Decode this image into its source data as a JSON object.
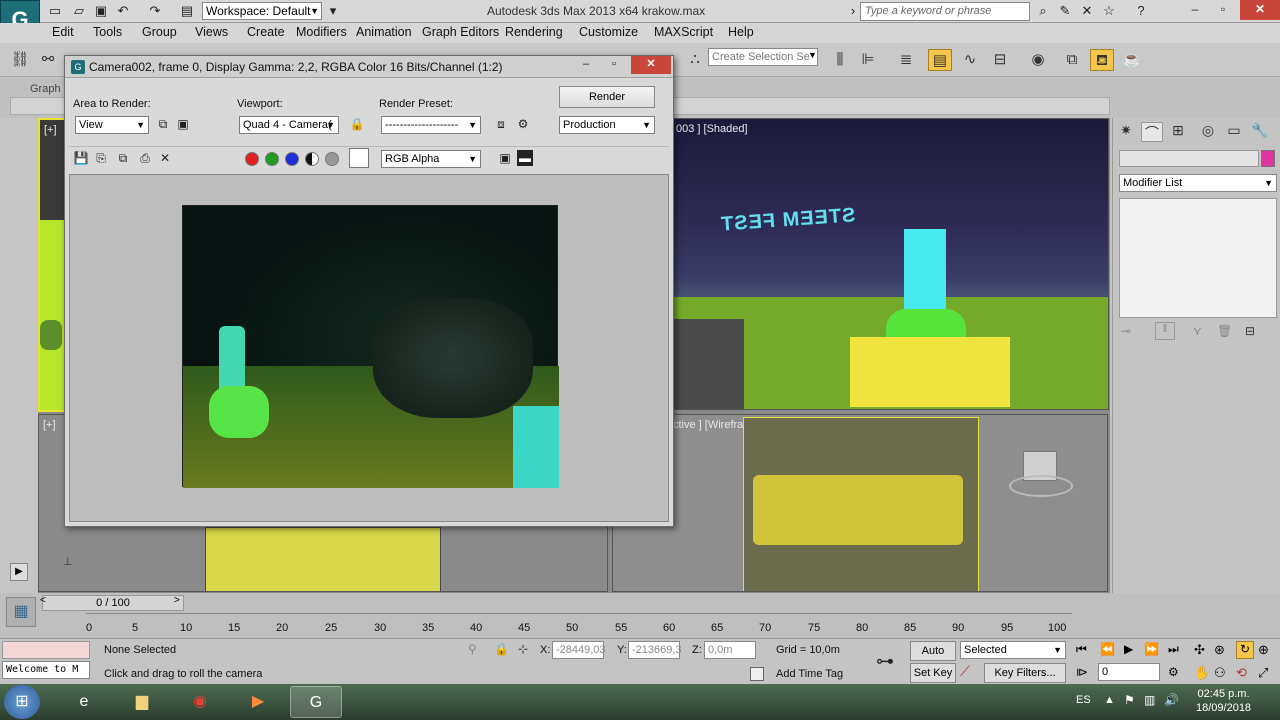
{
  "app": {
    "title": "Autodesk 3ds Max  2013 x64    krakow.max",
    "logo": "G",
    "workspace": "Workspace: Default",
    "search_placeholder": "Type a keyword or phrase"
  },
  "menu": [
    "Edit",
    "Tools",
    "Group",
    "Views",
    "Create",
    "Modifiers",
    "Animation",
    "Graph Editors",
    "Rendering",
    "Customize",
    "MAXScript",
    "Help"
  ],
  "toolbar": {
    "selection_set": "Create Selection Se"
  },
  "ribbon": {
    "tab": "Graph"
  },
  "viewports": {
    "top_right_label": "003 ] [Shaded]",
    "bottom_right_label": "ctive ] [Wireframe]",
    "top_left_label": "[+]",
    "bottom_left_label": "[+]",
    "sign_text": "STEEM FEST"
  },
  "command_panel": {
    "modifier_list": "Modifier List"
  },
  "render_window": {
    "title": "Camera002, frame 0, Display Gamma: 2,2, RGBA Color 16 Bits/Channel (1:2)",
    "area_label": "Area to Render:",
    "area_value": "View",
    "viewport_label": "Viewport:",
    "viewport_value": "Quad 4 - Camera(",
    "preset_label": "Render Preset:",
    "preset_value": "--------------------",
    "render_button": "Render",
    "production_value": "Production",
    "channel_value": "RGB Alpha"
  },
  "timeline": {
    "frame_slider": "0 / 100",
    "ticks": [
      "0",
      "5",
      "10",
      "15",
      "20",
      "25",
      "30",
      "35",
      "40",
      "45",
      "50",
      "55",
      "60",
      "65",
      "70",
      "75",
      "80",
      "85",
      "90",
      "95",
      "100"
    ]
  },
  "status": {
    "maxscript": "Welcome to M",
    "selection": "None Selected",
    "prompt": "Click and drag to roll the camera",
    "x_label": "X:",
    "x_value": "-28449,03",
    "y_label": "Y:",
    "y_value": "-213669,3",
    "z_label": "Z:",
    "z_value": "0,0m",
    "grid": "Grid = 10,0m",
    "add_time_tag": "Add Time Tag",
    "auto_key": "Auto Key",
    "set_key": "Set Key",
    "selected": "Selected",
    "key_filters": "Key Filters...",
    "frame_value": "0"
  },
  "taskbar": {
    "lang": "ES",
    "time": "02:45 p.m.",
    "date": "18/09/2018"
  }
}
